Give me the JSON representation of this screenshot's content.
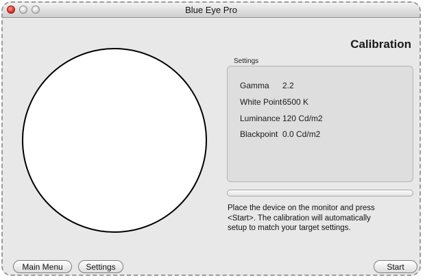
{
  "window": {
    "title": "Blue Eye Pro"
  },
  "header": {
    "title": "Calibration"
  },
  "settings": {
    "label": "Settings",
    "rows": [
      {
        "label": "Gamma",
        "value": "2.2"
      },
      {
        "label": "White Point",
        "value": "6500 K"
      },
      {
        "label": "Luminance",
        "value": "120 Cd/m2"
      },
      {
        "label": "Blackpoint",
        "value": "0.0 Cd/m2"
      }
    ]
  },
  "progress": {
    "value": 0
  },
  "instructions": {
    "line1": "Place the device on the monitor and press",
    "line2": "<Start>. The calibration will automatically",
    "line3": "setup to match your target settings."
  },
  "buttons": {
    "main_menu": "Main Menu",
    "settings": "Settings",
    "start": "Start"
  },
  "colors": {
    "window_bg": "#e8e8e8",
    "close_button": "#d2261b",
    "circle_fill": "#ffffff",
    "circle_stroke": "#000000"
  }
}
